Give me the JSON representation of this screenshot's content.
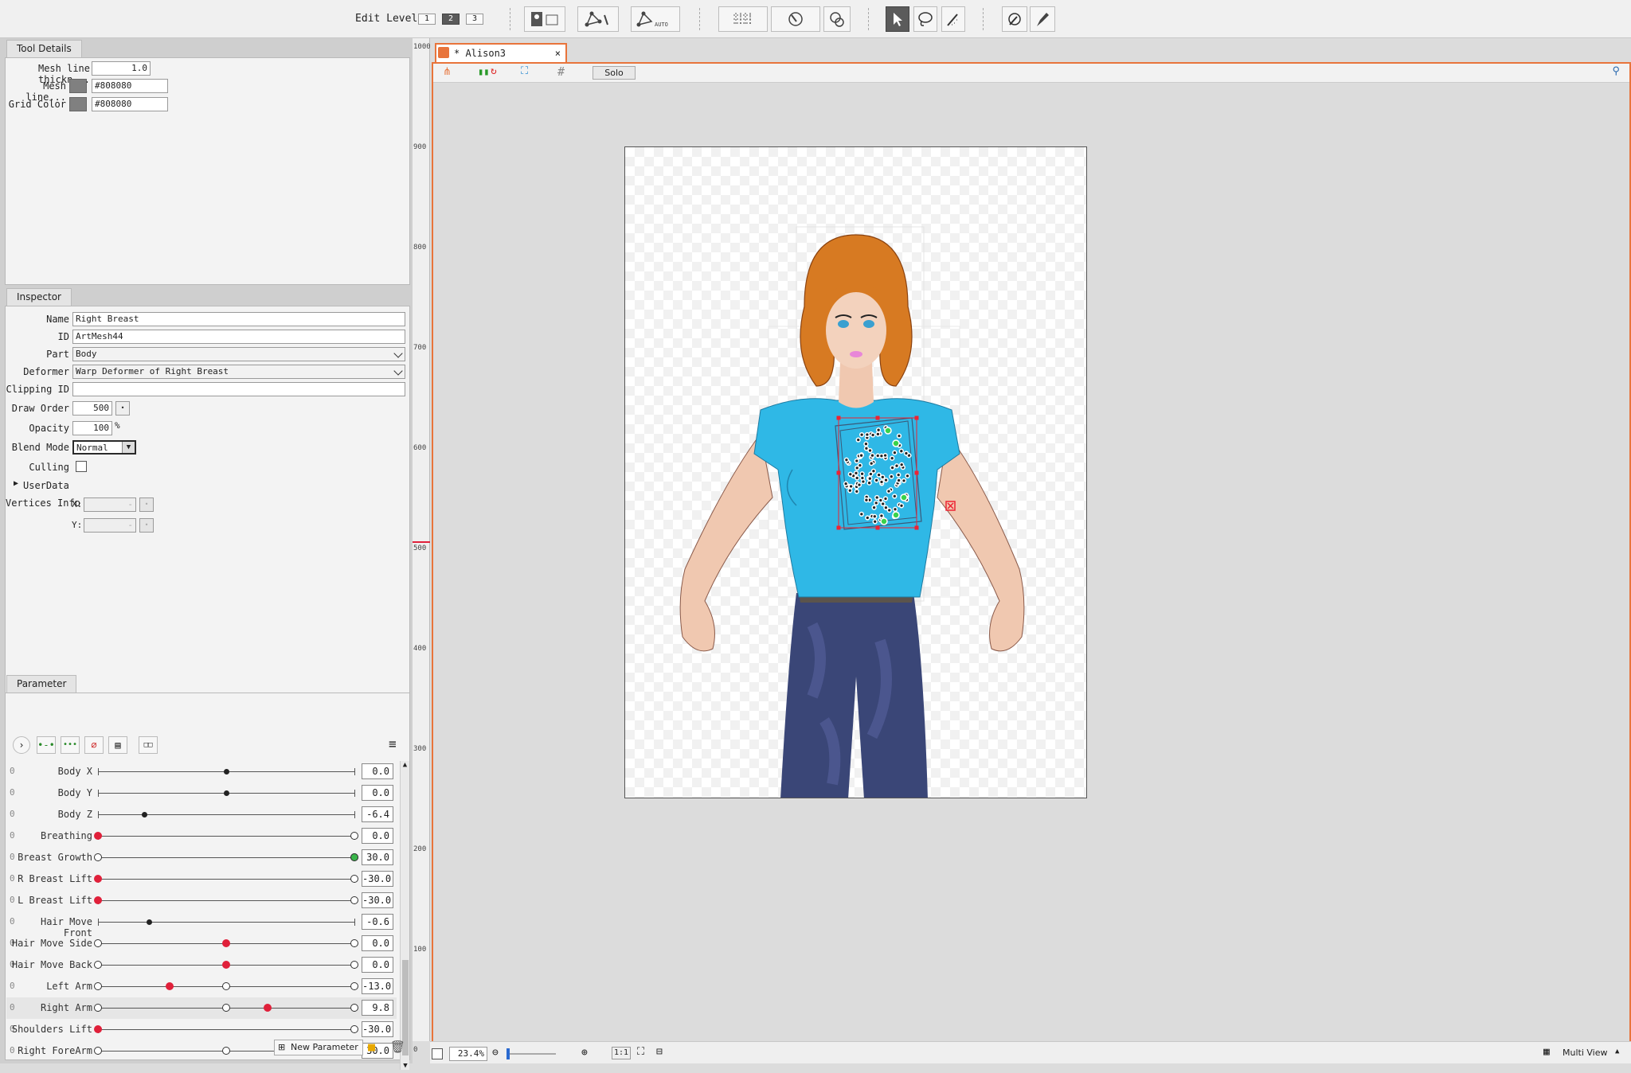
{
  "toolbar": {
    "edit_level_label": "Edit Level:",
    "levels": [
      "1",
      "2",
      "3"
    ],
    "active_level": "2"
  },
  "tool_details": {
    "tab": "Tool Details",
    "rows": [
      {
        "label": "Mesh line thickn...",
        "value": "1.0"
      },
      {
        "label": "Mesh line...",
        "value": "#808080"
      },
      {
        "label": "Grid Color",
        "value": "#808080"
      }
    ],
    "swatch_color": "#808080"
  },
  "inspector": {
    "tab": "Inspector",
    "name_label": "Name",
    "name": "Right Breast",
    "id_label": "ID",
    "id": "ArtMesh44",
    "part_label": "Part",
    "part": "Body",
    "deformer_label": "Deformer",
    "deformer": "Warp Deformer of Right Breast",
    "clipping_label": "Clipping ID",
    "clipping": "",
    "draw_order_label": "Draw Order",
    "draw_order": "500",
    "opacity_label": "Opacity",
    "opacity": "100",
    "opacity_unit": "%",
    "blend_label": "Blend Mode",
    "blend": "Normal",
    "culling_label": "Culling",
    "userdata_label": "UserData",
    "vertices_label": "Vertices Info",
    "x_label": "X:",
    "y_label": "Y:",
    "dash": "-"
  },
  "parameter": {
    "tab": "Parameter",
    "new_label": "New Parameter",
    "zero": "0",
    "rows": [
      {
        "name": "Body X",
        "value": "0.0",
        "pos": 0.5,
        "type": "dot",
        "keys": []
      },
      {
        "name": "Body Y",
        "value": "0.0",
        "pos": 0.5,
        "type": "dot",
        "keys": []
      },
      {
        "name": "Body Z",
        "value": "-6.4",
        "pos": 0.18,
        "type": "dot",
        "keys": []
      },
      {
        "name": "Breathing",
        "value": "0.0",
        "pos": 0.0,
        "type": "red",
        "keys": [
          1.0
        ]
      },
      {
        "name": "Breast Growth",
        "value": "30.0",
        "pos": 1.0,
        "type": "green",
        "keys": [
          0.0,
          1.0
        ]
      },
      {
        "name": "R Breast Lift",
        "value": "-30.0",
        "pos": 0.0,
        "type": "red",
        "keys": [
          1.0
        ]
      },
      {
        "name": "L Breast Lift",
        "value": "-30.0",
        "pos": 0.0,
        "type": "red",
        "keys": [
          1.0
        ]
      },
      {
        "name": "Hair Move Front",
        "value": "-0.6",
        "pos": 0.2,
        "type": "dot",
        "keys": []
      },
      {
        "name": "Hair Move Side",
        "value": "0.0",
        "pos": 0.5,
        "type": "red",
        "keys": [
          0.0,
          1.0
        ]
      },
      {
        "name": "Hair Move Back",
        "value": "0.0",
        "pos": 0.5,
        "type": "red",
        "keys": [
          0.0,
          1.0
        ]
      },
      {
        "name": "Left Arm",
        "value": "-13.0",
        "pos": 0.28,
        "type": "red",
        "keys": [
          0.0,
          0.5,
          1.0
        ]
      },
      {
        "name": "Right Arm",
        "value": "9.8",
        "pos": 0.66,
        "type": "red",
        "keys": [
          0.0,
          0.5,
          1.0
        ]
      },
      {
        "name": "Shoulders Lift",
        "value": "-30.0",
        "pos": 0.0,
        "type": "red",
        "keys": [
          1.0
        ]
      },
      {
        "name": "Right ForeArm",
        "value": "30.0",
        "pos": 1.0,
        "type": "red",
        "keys": [
          0.0,
          0.5
        ]
      }
    ]
  },
  "ruler": [
    "1000",
    "900",
    "800",
    "700",
    "600",
    "500",
    "400",
    "300",
    "200",
    "100",
    "0"
  ],
  "document": {
    "tab_title": "* Alison3",
    "solo_label": "Solo"
  },
  "statusbar": {
    "zoom": "23.4%",
    "ratio": "1:1",
    "view": "Multi View"
  },
  "colors": {
    "accent": "#e8743b",
    "key_red": "#e0203a"
  }
}
